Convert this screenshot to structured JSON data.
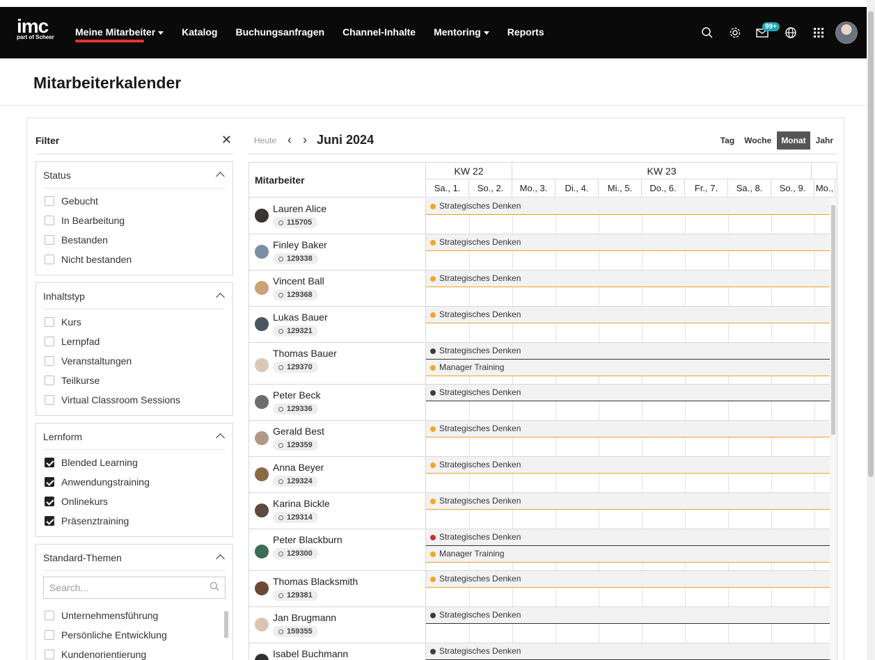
{
  "topbar": {
    "logo": "imc",
    "logo_sub": "part of Scheer",
    "nav": [
      {
        "label": "Meine Mitarbeiter",
        "dropdown": true,
        "active": true
      },
      {
        "label": "Katalog"
      },
      {
        "label": "Buchungsanfragen"
      },
      {
        "label": "Channel-Inhalte"
      },
      {
        "label": "Mentoring",
        "dropdown": true
      },
      {
        "label": "Reports"
      }
    ],
    "notifications_badge": "99+",
    "icons": [
      "search-icon",
      "settings-icon",
      "mail-icon",
      "globe-icon",
      "apps-grid-icon"
    ]
  },
  "page_title": "Mitarbeiterkalender",
  "filter": {
    "title": "Filter",
    "groups": [
      {
        "title": "Status",
        "options": [
          {
            "label": "Gebucht",
            "checked": false
          },
          {
            "label": "In Bearbeitung",
            "checked": false
          },
          {
            "label": "Bestanden",
            "checked": false
          },
          {
            "label": "Nicht bestanden",
            "checked": false
          }
        ]
      },
      {
        "title": "Inhaltstyp",
        "options": [
          {
            "label": "Kurs",
            "checked": false
          },
          {
            "label": "Lernpfad",
            "checked": false
          },
          {
            "label": "Veranstaltungen",
            "checked": false
          },
          {
            "label": "Teilkurse",
            "checked": false
          },
          {
            "label": "Virtual Classroom Sessions",
            "checked": false
          }
        ]
      },
      {
        "title": "Lernform",
        "options": [
          {
            "label": "Blended Learning",
            "checked": true
          },
          {
            "label": "Anwendungstraining",
            "checked": true
          },
          {
            "label": "Onlinekurs",
            "checked": true
          },
          {
            "label": "Präsenztraining",
            "checked": true
          }
        ]
      },
      {
        "title": "Standard-Themen",
        "search_placeholder": "Search...",
        "options": [
          {
            "label": "Unternehmensführung",
            "checked": false
          },
          {
            "label": "Persönliche Entwicklung",
            "checked": false
          },
          {
            "label": "Kundenorientierung",
            "checked": false
          }
        ]
      }
    ]
  },
  "calendar": {
    "today": "Heute",
    "month": "Juni 2024",
    "views": [
      "Tag",
      "Woche",
      "Monat",
      "Jahr"
    ],
    "active_view": "Monat",
    "employee_header": "Mitarbeiter",
    "weeks": [
      "KW 22",
      "KW 23"
    ],
    "days": [
      "Sa., 1.",
      "So., 2.",
      "Mo., 3.",
      "Di., 4.",
      "Mi., 5.",
      "Do., 6.",
      "Fr., 7.",
      "Sa., 8.",
      "So., 9.",
      "Mo.,"
    ],
    "employees": [
      {
        "name": "Lauren Alice",
        "id": "115705",
        "avatar": "#3b3530",
        "events": [
          {
            "title": "Strategisches Denken",
            "color": "#f5a623"
          }
        ]
      },
      {
        "name": "Finley Baker",
        "id": "129338",
        "avatar": "#7a8fa3",
        "events": [
          {
            "title": "Strategisches Denken",
            "color": "#f5a623"
          }
        ]
      },
      {
        "name": "Vincent Ball",
        "id": "129368",
        "avatar": "#c9a27a",
        "events": [
          {
            "title": "Strategisches Denken",
            "color": "#f5a623"
          }
        ]
      },
      {
        "name": "Lukas Bauer",
        "id": "129321",
        "avatar": "#4a5560",
        "events": [
          {
            "title": "Strategisches Denken",
            "color": "#f5a623"
          }
        ]
      },
      {
        "name": "Thomas Bauer",
        "id": "129370",
        "avatar": "#d9c8b8",
        "events": [
          {
            "title": "Strategisches Denken",
            "color": "#3a3d4a"
          },
          {
            "title": "Manager Training",
            "color": "#f5a623"
          }
        ]
      },
      {
        "name": "Peter Beck",
        "id": "129336",
        "avatar": "#6d6d6d",
        "events": [
          {
            "title": "Strategisches Denken",
            "color": "#3a3d4a"
          }
        ]
      },
      {
        "name": "Gerald Best",
        "id": "129359",
        "avatar": "#b09a86",
        "events": [
          {
            "title": "Strategisches Denken",
            "color": "#f5a623"
          }
        ]
      },
      {
        "name": "Anna Beyer",
        "id": "129324",
        "avatar": "#8a6a45",
        "events": [
          {
            "title": "Strategisches Denken",
            "color": "#f5a623"
          }
        ]
      },
      {
        "name": "Karina Bickle",
        "id": "129314",
        "avatar": "#5b4a40",
        "events": [
          {
            "title": "Strategisches Denken",
            "color": "#f5a623"
          }
        ]
      },
      {
        "name": "Peter Blackburn",
        "id": "129300",
        "avatar": "#3f6b5a",
        "events": [
          {
            "title": "Strategisches Denken",
            "color": "#c0392b"
          },
          {
            "title": "Manager Training",
            "color": "#f5a623"
          }
        ]
      },
      {
        "name": "Thomas Blacksmith",
        "id": "129381",
        "avatar": "#6b4a35",
        "events": [
          {
            "title": "Strategisches Denken",
            "color": "#f5a623"
          }
        ]
      },
      {
        "name": "Jan Brugmann",
        "id": "159355",
        "avatar": "#d8c6b2",
        "events": [
          {
            "title": "Strategisches Denken",
            "color": "#3a3d4a"
          }
        ]
      },
      {
        "name": "Isabel Buchmann",
        "id": "",
        "avatar": "#2f2f2f",
        "events": [
          {
            "title": "Strategisches Denken",
            "color": "#3a3d4a"
          }
        ]
      }
    ]
  }
}
